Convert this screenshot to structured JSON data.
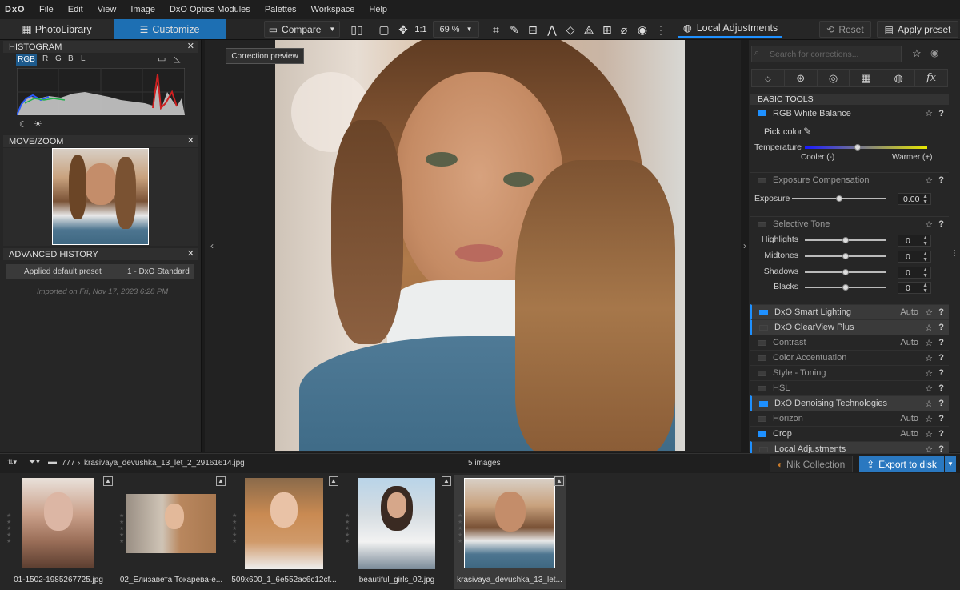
{
  "menubar": {
    "logo": "DxO",
    "items": [
      "File",
      "Edit",
      "View",
      "Image",
      "DxO Optics Modules",
      "Palettes",
      "Workspace",
      "Help"
    ]
  },
  "toolbar": {
    "tabs": [
      "PhotoLibrary",
      "Customize"
    ],
    "compare_label": "Compare",
    "zoom_ratio": "1:1",
    "zoom_value": "69 %",
    "local_adjustments_label": "Local Adjustments",
    "reset_label": "Reset",
    "apply_preset_label": "Apply preset",
    "tooltip": "Correction preview"
  },
  "left": {
    "histogram": {
      "title": "HISTOGRAM",
      "channels": [
        "RGB",
        "R",
        "G",
        "B",
        "L"
      ],
      "active_channel": "RGB"
    },
    "movezoom_title": "MOVE/ZOOM",
    "history": {
      "title": "ADVANCED HISTORY",
      "entry_action": "Applied default preset",
      "entry_preset": "1 - DxO Standard",
      "imported": "Imported on Fri, Nov 17, 2023 6:28 PM"
    }
  },
  "right": {
    "search_placeholder": "Search for corrections...",
    "section_title": "BASIC TOOLS",
    "white_balance": {
      "title": "RGB White Balance",
      "pick_color": "Pick color",
      "temperature": "Temperature",
      "cooler": "Cooler (-)",
      "warmer": "Warmer (+)",
      "temperature_level": 0.43
    },
    "exposure": {
      "title": "Exposure Compensation",
      "label": "Exposure",
      "value": "0.00"
    },
    "selective_tone": {
      "title": "Selective Tone",
      "rows": [
        {
          "label": "Highlights",
          "value": "0"
        },
        {
          "label": "Midtones",
          "value": "0"
        },
        {
          "label": "Shadows",
          "value": "0"
        },
        {
          "label": "Blacks",
          "value": "0"
        }
      ]
    },
    "modules": [
      {
        "label": "DxO Smart Lighting",
        "auto": "Auto",
        "on": true,
        "highlight": true
      },
      {
        "label": "DxO ClearView Plus",
        "auto": "",
        "on": false,
        "highlight": true
      },
      {
        "label": "Contrast",
        "auto": "Auto",
        "on": false,
        "highlight": false
      },
      {
        "label": "Color Accentuation",
        "auto": "",
        "on": false,
        "highlight": false
      },
      {
        "label": "Style - Toning",
        "auto": "",
        "on": false,
        "highlight": false
      },
      {
        "label": "HSL",
        "auto": "",
        "on": false,
        "highlight": false
      },
      {
        "label": "DxO Denoising Technologies",
        "auto": "",
        "on": true,
        "highlight": true
      },
      {
        "label": "Horizon",
        "auto": "Auto",
        "on": false,
        "highlight": false
      },
      {
        "label": "Crop",
        "auto": "Auto",
        "on": true,
        "highlight": false
      },
      {
        "label": "Local Adjustments",
        "auto": "",
        "on": false,
        "highlight": true
      }
    ]
  },
  "filmstrip": {
    "folder": "777",
    "file": "krasivaya_devushka_13_let_2_29161614.jpg",
    "count": "5 images",
    "nik_label": "Nik Collection",
    "export_label": "Export to disk",
    "thumbs": [
      "01-1502-1985267725.jpg",
      "02_Елизавета Токарева-е...",
      "509x600_1_6e552ac6c12cf...",
      "beautiful_girls_02.jpg",
      "krasivaya_devushka_13_let..."
    ]
  },
  "colors": {
    "accent": "#1e90ff",
    "active_tab": "#1d6fb3",
    "export_button": "#2a78c0"
  }
}
